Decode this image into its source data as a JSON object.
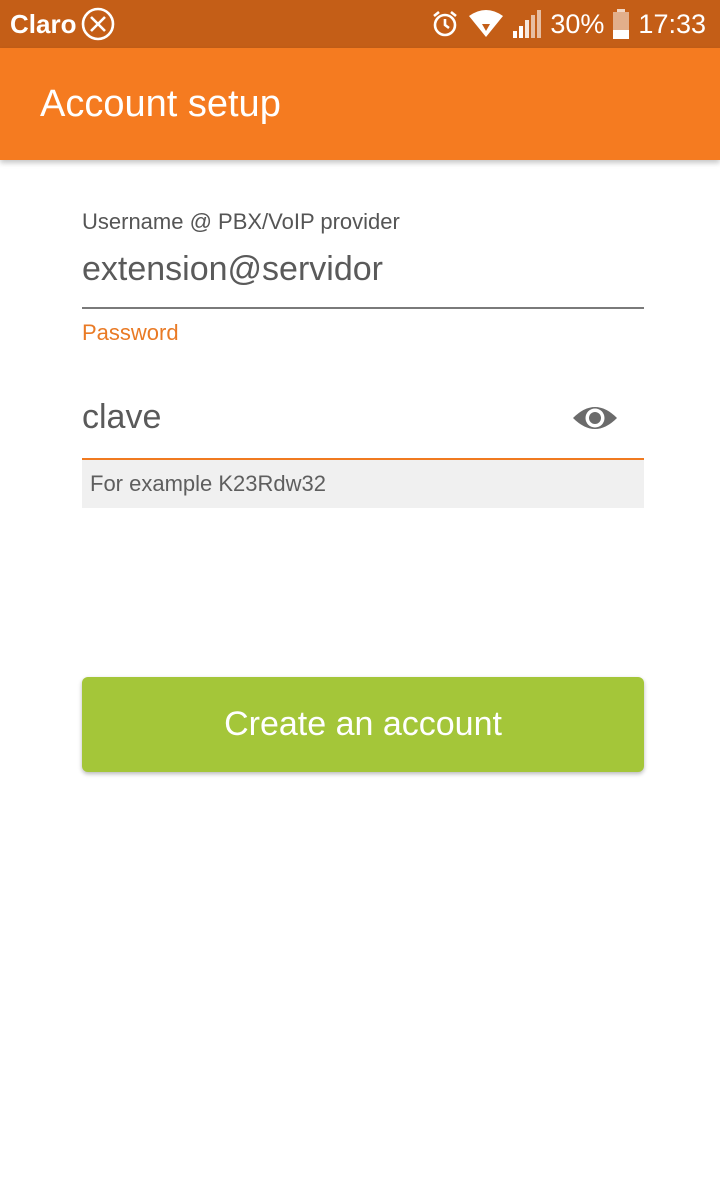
{
  "status_bar": {
    "carrier": "Claro",
    "battery": "30%",
    "time": "17:33",
    "icons": [
      "no-sim-icon",
      "alarm-icon",
      "wifi-icon",
      "signal-icon",
      "battery-icon"
    ]
  },
  "app_bar": {
    "title": "Account setup",
    "color": "#f57b20"
  },
  "form": {
    "username": {
      "label": "Username @ PBX/VoIP provider",
      "value": "extension@servidor"
    },
    "password": {
      "label": "Password",
      "value": "clave",
      "helper": "For example K23Rdw32",
      "toggle_icon": "eye-icon"
    },
    "submit_label": "Create an account",
    "submit_color": "#a4c639",
    "accent_color": "#e97a25"
  }
}
